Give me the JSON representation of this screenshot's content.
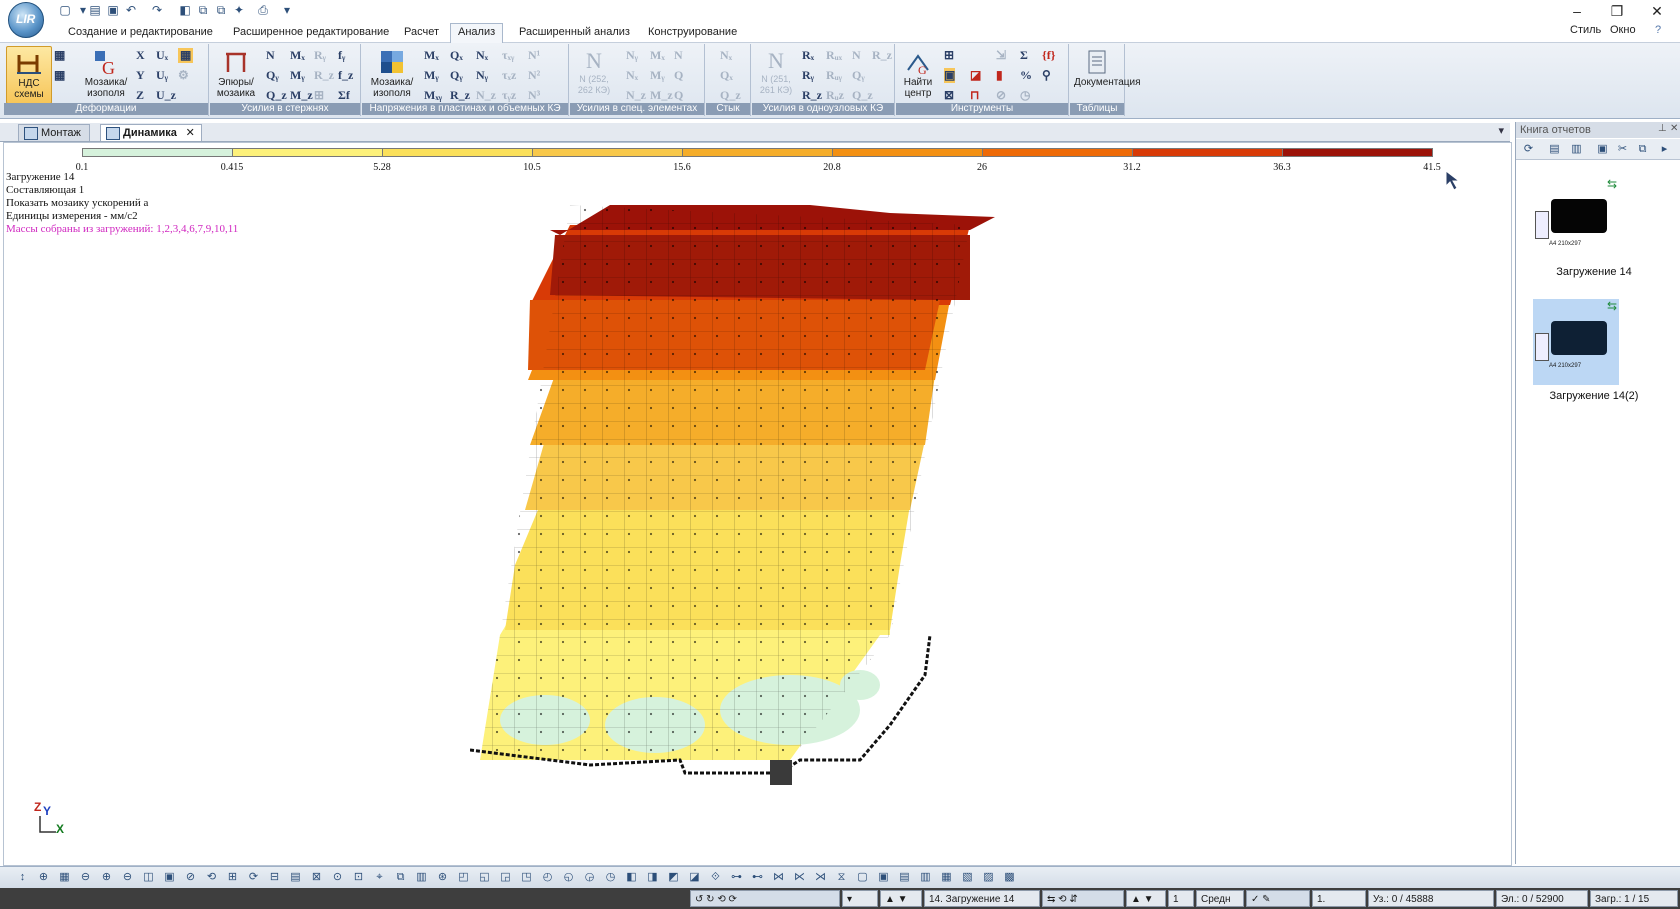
{
  "window": {
    "minimize": "–",
    "restore": "❐",
    "close": "✕"
  },
  "ribbon_tabs": [
    "Создание и редактирование",
    "Расширенное редактирование",
    "Расчет",
    "Анализ",
    "Расширенный анализ",
    "Конструирование"
  ],
  "active_tab": "Анализ",
  "menu_right": {
    "style": "Стиль",
    "window": "Окно"
  },
  "ribbon_groups": {
    "deformations": {
      "label": "Деформации",
      "nds_button": "НДС схемы",
      "mosaic_button": "Мозаика/ изополя"
    },
    "rod_forces": {
      "label": "Усилия в стержнях",
      "epure_button": "Эпюры/ мозаика"
    },
    "plate_stress": {
      "label": "Напряжения в пластинах и объемных КЭ",
      "mosaic_button": "Мозаика/ изополя"
    },
    "special_elements": {
      "label": "Усилия в спец. элементах",
      "big_text": "N (252, 262 КЭ)"
    },
    "joint": {
      "label": "Стык"
    },
    "single_node": {
      "label": "Усилия в одноузловых КЭ",
      "big_text": "N (251, 261 КЭ)"
    },
    "tools": {
      "label": "Инструменты",
      "find_center": "Найти центр"
    },
    "tables": {
      "label": "Таблицы",
      "documentation": "Документация"
    }
  },
  "doc_tabs": [
    {
      "label": "Монтаж",
      "active": false
    },
    {
      "label": "Динамика",
      "active": true
    }
  ],
  "legend": {
    "ticks": [
      "0.1",
      "0.415",
      "5.28",
      "10.5",
      "15.6",
      "20.8",
      "26",
      "31.2",
      "36.3",
      "41.5"
    ],
    "colors": [
      "#d6f2dc",
      "#fdf17a",
      "#fbe05a",
      "#f8c84a",
      "#f5ad2a",
      "#f39012",
      "#ee6a07",
      "#d83a06",
      "#9c1208"
    ]
  },
  "info": {
    "load": "Загружение 14",
    "component": "Составляющая  1",
    "mosaic": "Показать мозаику ускорений a",
    "units": "Единицы измерения - мм/с2",
    "masses": "Массы собраны из загружений:  1,2,3,4,6,7,9,10,11"
  },
  "axes": {
    "z": "Z",
    "y": "Y",
    "x": "X"
  },
  "report_panel": {
    "title": "Книга отчетов",
    "items": [
      {
        "label": "Загружение 14",
        "paper": "A4 210x297",
        "selected": false
      },
      {
        "label": "Загружение 14(2)",
        "paper": "A4 210x297",
        "selected": true
      }
    ]
  },
  "status": {
    "load_select": "14. Загружение 14",
    "number_field": "1",
    "mode_select": "Средн",
    "scale_field": "1.",
    "nodes": "Уз.: 0 / 45888",
    "elements": "Эл.: 0 / 52900",
    "loads": "Загр.: 1 / 15"
  }
}
